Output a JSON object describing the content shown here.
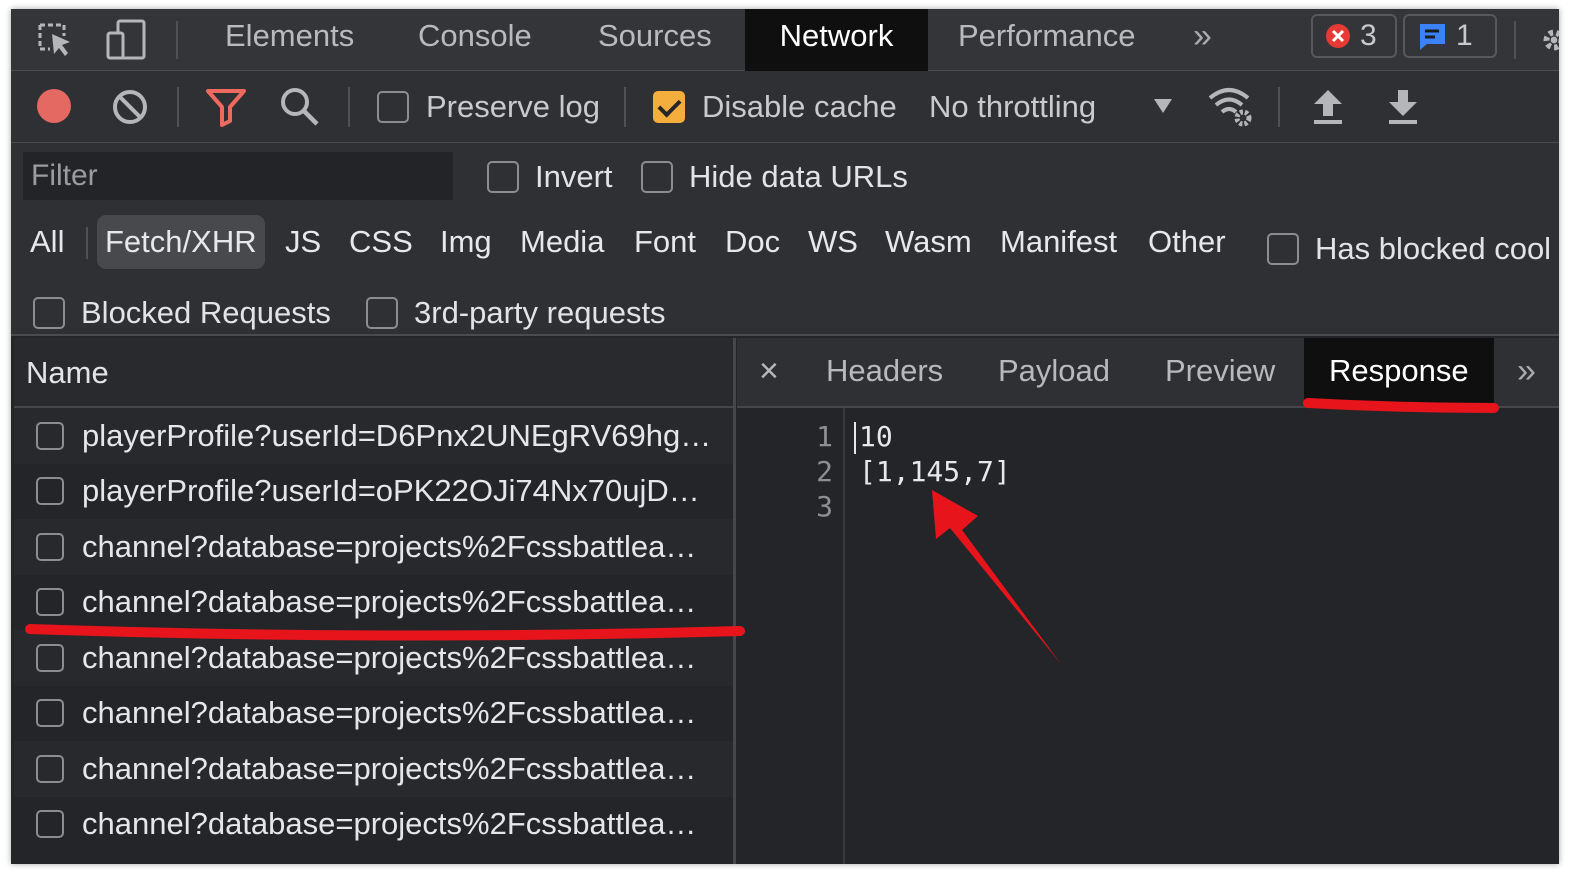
{
  "tabs": [
    "Elements",
    "Console",
    "Sources",
    "Network",
    "Performance"
  ],
  "active_tab": "Network",
  "more_tabs_glyph": "»",
  "errors_count": "3",
  "messages_count": "1",
  "toolbar": {
    "preserve_log": "Preserve log",
    "preserve_log_checked": false,
    "disable_cache": "Disable cache",
    "disable_cache_checked": true,
    "throttling": "No throttling"
  },
  "filter": {
    "placeholder": "Filter",
    "invert": "Invert",
    "hide_data_urls": "Hide data URLs",
    "types": [
      "All",
      "Fetch/XHR",
      "JS",
      "CSS",
      "Img",
      "Media",
      "Font",
      "Doc",
      "WS",
      "Wasm",
      "Manifest",
      "Other"
    ],
    "active_type": "Fetch/XHR",
    "has_blocked_cookies": "Has blocked cool",
    "blocked_requests": "Blocked Requests",
    "third_party": "3rd-party requests"
  },
  "request_list": {
    "header": "Name",
    "rows": [
      "playerProfile?userId=D6Pnx2UNEgRV69hg…",
      "playerProfile?userId=oPK22OJi74Nx70ujD…",
      "channel?database=projects%2Fcssbattlea…",
      "channel?database=projects%2Fcssbattlea…",
      "channel?database=projects%2Fcssbattlea…",
      "channel?database=projects%2Fcssbattlea…",
      "channel?database=projects%2Fcssbattlea…",
      "channel?database=projects%2Fcssbattlea…"
    ],
    "highlighted_row": 4
  },
  "detail": {
    "close": "×",
    "tabs": [
      "Headers",
      "Payload",
      "Preview",
      "Response"
    ],
    "active_tab": "Response",
    "more_glyph": "»",
    "response_lines": [
      {
        "number": "1",
        "text": "10"
      },
      {
        "number": "2",
        "text": "[1,145,7]"
      },
      {
        "number": "3",
        "text": ""
      }
    ]
  },
  "colors": {
    "annotation_red": "#e8141c",
    "record_red": "#e46962",
    "filter_icon": "#ef6a5e",
    "checkbox_checked": "#f3ae3d",
    "error_badge": "#e53a35",
    "message_badge": "#3b82f6"
  },
  "icons": [
    "inspect-element-icon",
    "device-toolbar-icon",
    "record-icon",
    "clear-icon",
    "filter-icon",
    "search-icon",
    "network-conditions-icon",
    "import-har-icon",
    "export-har-icon",
    "error-icon",
    "message-icon",
    "settings-icon",
    "more-tabs-icon",
    "close-icon",
    "dropdown-arrow-icon"
  ]
}
